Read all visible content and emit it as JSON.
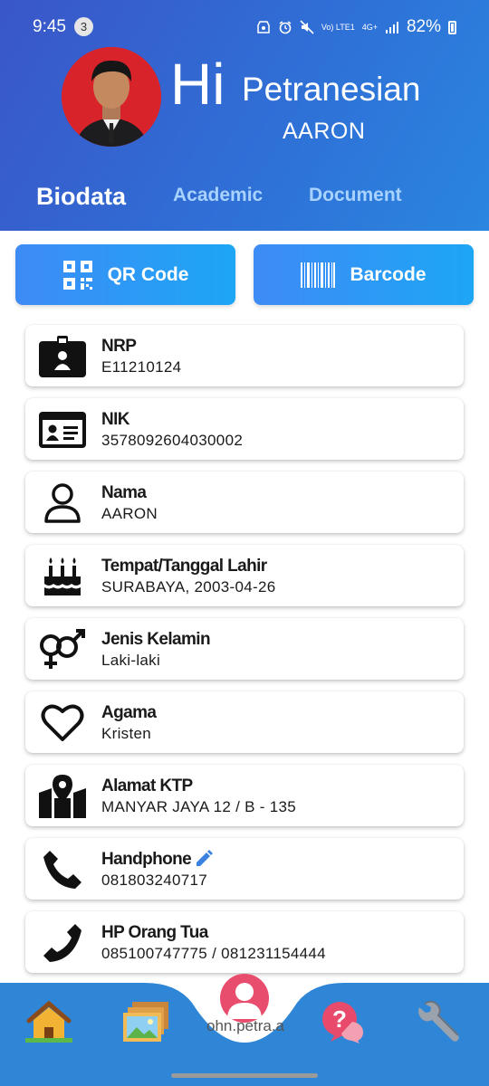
{
  "status": {
    "time": "9:45",
    "notif_count": "3",
    "net": "Vo) LTE1",
    "net2": "4G+",
    "battery": "82%"
  },
  "header": {
    "hi": "Hi",
    "greeting": "Petranesian",
    "name": "AARON"
  },
  "tabs": [
    {
      "label": "Biodata"
    },
    {
      "label": "Academic"
    },
    {
      "label": "Document"
    }
  ],
  "actions": {
    "qr": "QR Code",
    "barcode": "Barcode"
  },
  "fields": [
    {
      "label": "NRP",
      "value": "E11210124",
      "icon": "id-badge-icon"
    },
    {
      "label": "NIK",
      "value": "3578092604030002",
      "icon": "id-card-icon"
    },
    {
      "label": "Nama",
      "value": "AARON",
      "icon": "user-icon"
    },
    {
      "label": "Tempat/Tanggal Lahir",
      "value": "SURABAYA, 2003-04-26",
      "icon": "birthday-cake-icon"
    },
    {
      "label": "Jenis Kelamin",
      "value": "Laki-laki",
      "icon": "gender-icon"
    },
    {
      "label": "Agama",
      "value": "Kristen",
      "icon": "heart-icon"
    },
    {
      "label": "Alamat KTP",
      "value": "MANYAR JAYA 12 / B - 135",
      "icon": "map-marker-icon"
    },
    {
      "label": "Handphone",
      "value": "081803240717",
      "icon": "phone-icon"
    },
    {
      "label": "HP Orang Tua",
      "value": "085100747775 / 081231154444",
      "icon": "phone-icon"
    }
  ],
  "bottom_nav": {
    "url_fragment": "ohn.petra.a"
  },
  "colors": {
    "header_start": "#3a56c8",
    "header_end": "#2a86e0",
    "nav_bg": "#2f86d6",
    "accent_pink": "#e94d6d"
  }
}
